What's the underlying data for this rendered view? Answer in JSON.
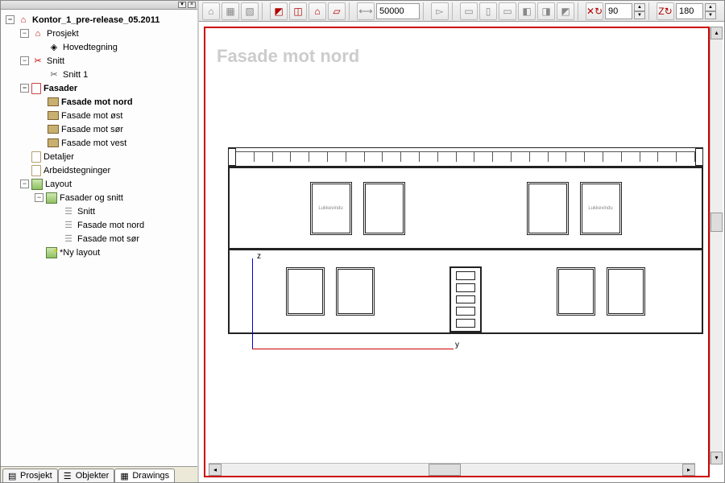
{
  "project": {
    "root": "Kontor_1_pre-release_05.2011",
    "prosjekt": {
      "label": "Prosjekt",
      "children": [
        {
          "label": "Hovedtegning"
        }
      ]
    },
    "snitt": {
      "label": "Snitt",
      "children": [
        {
          "label": "Snitt 1"
        }
      ]
    },
    "fasader": {
      "label": "Fasader",
      "children": [
        {
          "label": "Fasade mot nord",
          "active": true
        },
        {
          "label": "Fasade mot øst"
        },
        {
          "label": "Fasade mot sør"
        },
        {
          "label": "Fasade mot vest"
        }
      ]
    },
    "detaljer": {
      "label": "Detaljer"
    },
    "arbeidstegninger": {
      "label": "Arbeidstegninger"
    },
    "layout": {
      "label": "Layout",
      "fasader_snitt": {
        "label": "Fasader og snitt",
        "children": [
          {
            "label": "Snitt"
          },
          {
            "label": "Fasade mot nord"
          },
          {
            "label": "Fasade mot sør"
          }
        ]
      },
      "ny_layout": "*Ny layout"
    }
  },
  "tabs": [
    {
      "label": "Prosjekt",
      "active": false
    },
    {
      "label": "Objekter",
      "active": false
    },
    {
      "label": "Drawings",
      "active": true
    }
  ],
  "toolbar": {
    "scale_value": "50000",
    "angle1_value": "90",
    "angle2_value": "180"
  },
  "canvas": {
    "title": "Fasade mot nord",
    "window_label_left": "Lukkevindu",
    "window_label_right": "Lukkevindu",
    "axis_z": "z",
    "axis_y": "y"
  }
}
